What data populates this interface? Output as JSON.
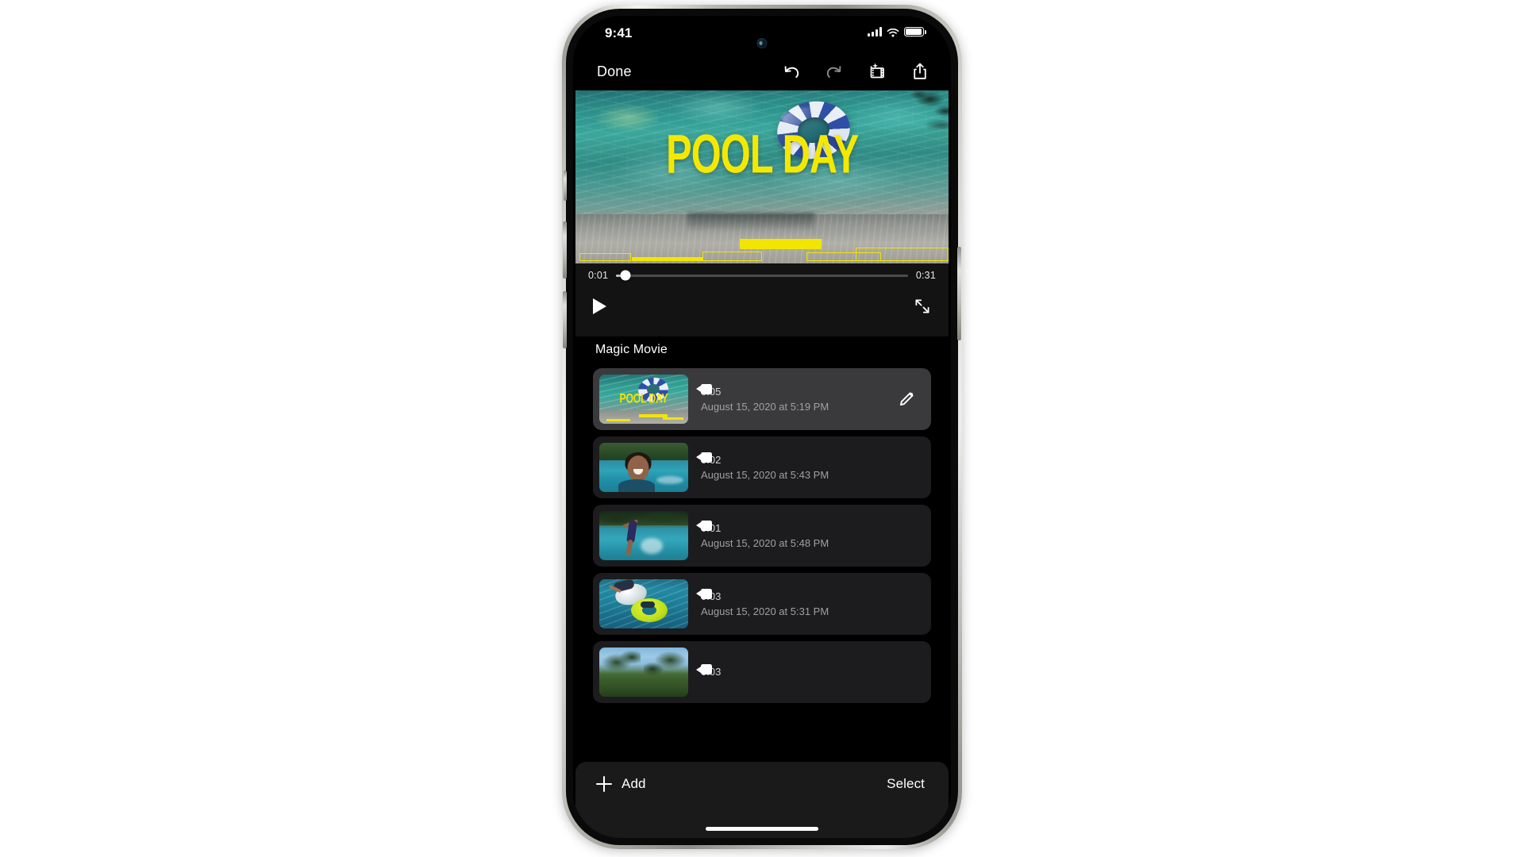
{
  "status_bar": {
    "time": "9:41",
    "cellular_icon": "cellular-signal-icon",
    "wifi_icon": "wifi-icon",
    "battery_icon": "battery-icon"
  },
  "top_toolbar": {
    "done_label": "Done",
    "actions": [
      {
        "name": "undo-icon",
        "label": "Undo"
      },
      {
        "name": "redo-icon",
        "label": "Redo"
      },
      {
        "name": "magic-movie-icon",
        "label": "Magic Movie"
      },
      {
        "name": "share-icon",
        "label": "Share"
      }
    ]
  },
  "preview": {
    "title_text": "POOL DAY",
    "title_color": "#f2e500",
    "overlay_icon": "yellow-waveform-overlay"
  },
  "player": {
    "current_time": "0:01",
    "total_time": "0:31",
    "progress_percent": 3.2,
    "play_icon": "play-icon",
    "expand_icon": "expand-fullscreen-icon"
  },
  "section": {
    "title": "Magic Movie"
  },
  "clips": [
    {
      "thumb": "pool-day-title-thumbnail",
      "media_icon": "video-camera-icon",
      "duration": "0:05",
      "date": "August 15, 2020 at 5:19 PM",
      "selected": true,
      "edit_icon": "pencil-edit-icon"
    },
    {
      "thumb": "girl-swimming-thumbnail",
      "media_icon": "video-camera-icon",
      "duration": "0:02",
      "date": "August 15, 2020 at 5:43 PM",
      "selected": false,
      "edit_icon": null
    },
    {
      "thumb": "child-jumping-into-pool-thumbnail",
      "media_icon": "video-camera-icon",
      "duration": "0:01",
      "date": "August 15, 2020 at 5:48 PM",
      "selected": false,
      "edit_icon": null
    },
    {
      "thumb": "green-float-thumbnail",
      "media_icon": "video-camera-icon",
      "duration": "0:03",
      "date": "August 15, 2020 at 5:31 PM",
      "selected": false,
      "edit_icon": null
    },
    {
      "thumb": "trees-and-sky-thumbnail",
      "media_icon": "video-camera-icon",
      "duration": "0:03",
      "date": "",
      "selected": false,
      "edit_icon": null
    }
  ],
  "bottom_toolbar": {
    "add_label": "Add",
    "add_icon": "plus-icon",
    "select_label": "Select"
  },
  "colors": {
    "accent_yellow": "#f2e500",
    "screen_background": "#000000",
    "row_background": "#1c1c1e",
    "row_selected_background": "#3a3a3c",
    "toolbar_background": "#1a1a1a"
  }
}
